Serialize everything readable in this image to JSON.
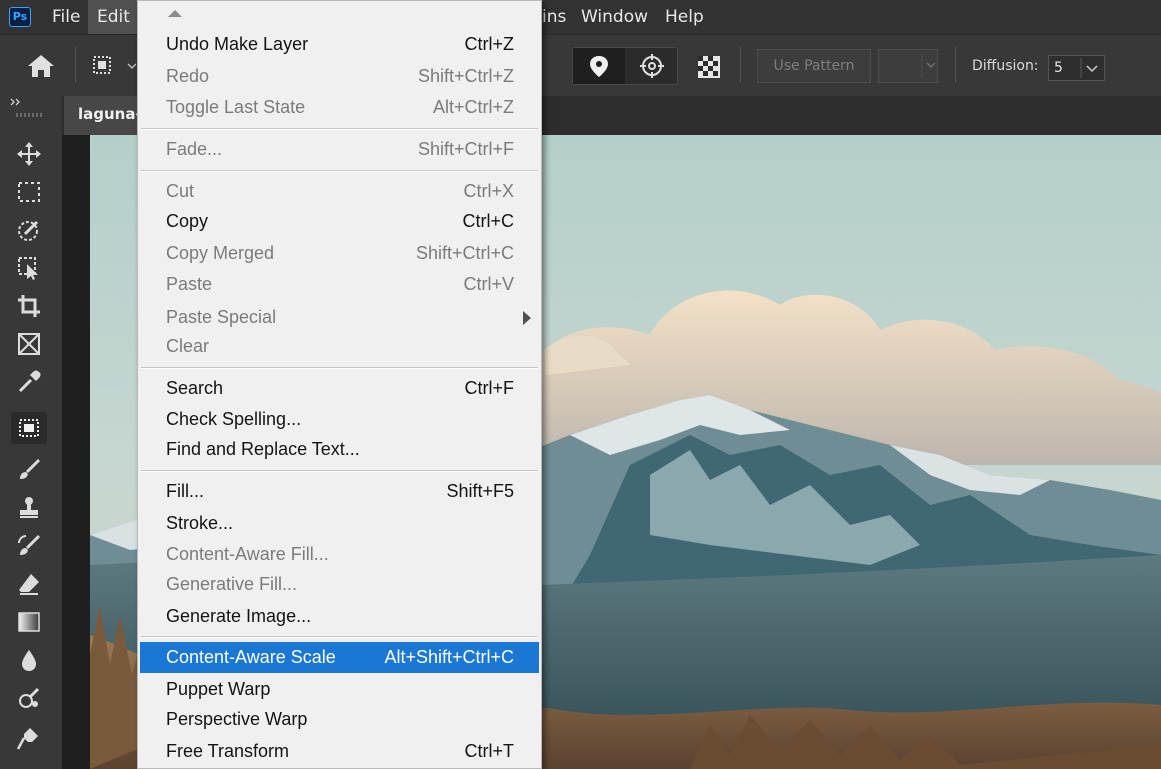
{
  "app": {
    "logo": "Ps"
  },
  "menubar": {
    "items": [
      "File",
      "Edit",
      "ins",
      "Window",
      "Help"
    ]
  },
  "options_bar": {
    "use_pattern_label": "Use Pattern",
    "diffusion_label": "Diffusion:",
    "diffusion_value": "5"
  },
  "document": {
    "tab_title": "laguna-"
  },
  "edit_menu": {
    "items": [
      {
        "label": "Undo Make Layer",
        "shortcut": "Ctrl+Z",
        "enabled": true
      },
      {
        "label": "Redo",
        "shortcut": "Shift+Ctrl+Z",
        "enabled": false
      },
      {
        "label": "Toggle Last State",
        "shortcut": "Alt+Ctrl+Z",
        "enabled": false
      },
      {
        "label": "Fade...",
        "shortcut": "Shift+Ctrl+F",
        "enabled": false
      },
      {
        "label": "Cut",
        "shortcut": "Ctrl+X",
        "enabled": false
      },
      {
        "label": "Copy",
        "shortcut": "Ctrl+C",
        "enabled": true
      },
      {
        "label": "Copy Merged",
        "shortcut": "Shift+Ctrl+C",
        "enabled": false
      },
      {
        "label": "Paste",
        "shortcut": "Ctrl+V",
        "enabled": false
      },
      {
        "label": "Paste Special",
        "shortcut": "",
        "enabled": false
      },
      {
        "label": "Clear",
        "shortcut": "",
        "enabled": false
      },
      {
        "label": "Search",
        "shortcut": "Ctrl+F",
        "enabled": true
      },
      {
        "label": "Check Spelling...",
        "shortcut": "",
        "enabled": true
      },
      {
        "label": "Find and Replace Text...",
        "shortcut": "",
        "enabled": true
      },
      {
        "label": "Fill...",
        "shortcut": "Shift+F5",
        "enabled": true
      },
      {
        "label": "Stroke...",
        "shortcut": "",
        "enabled": true
      },
      {
        "label": "Content-Aware Fill...",
        "shortcut": "",
        "enabled": false
      },
      {
        "label": "Generative Fill...",
        "shortcut": "",
        "enabled": false
      },
      {
        "label": "Generate Image...",
        "shortcut": "",
        "enabled": true
      },
      {
        "label": "Content-Aware Scale",
        "shortcut": "Alt+Shift+Ctrl+C",
        "enabled": true,
        "highlighted": true
      },
      {
        "label": "Puppet Warp",
        "shortcut": "",
        "enabled": true
      },
      {
        "label": "Perspective Warp",
        "shortcut": "",
        "enabled": true
      },
      {
        "label": "Free Transform",
        "shortcut": "Ctrl+T",
        "enabled": true
      }
    ]
  },
  "colors": {
    "menu_highlight": "#1a78d4",
    "menu_bg": "#f0f0f0",
    "app_bg": "#323232",
    "toolbar_bg": "#383838"
  },
  "icons": {
    "tools": [
      "move-icon",
      "marquee-icon",
      "quick-selection-icon",
      "object-selection-icon",
      "crop-icon",
      "frame-icon",
      "eyedropper-icon",
      "healing-icon",
      "brush-icon",
      "stamp-icon",
      "history-brush-icon",
      "eraser-icon",
      "gradient-icon",
      "blur-icon",
      "dodge-icon",
      "pen-icon"
    ]
  }
}
